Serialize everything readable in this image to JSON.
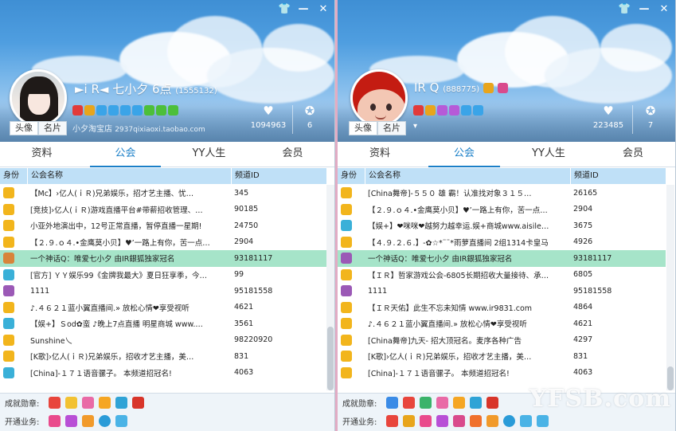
{
  "window_controls": {
    "skin": "👕",
    "minimize": "—",
    "close": "✕"
  },
  "left": {
    "nick": "►i R◄ 七小夕 6点",
    "uid": "(1555132)",
    "shop_label": "小夕淘宝店",
    "shop_url": "2937qixiaoxi.taobao.com",
    "likes": "1094963",
    "honor": "6",
    "mini_tabs": [
      "头像",
      "名片"
    ],
    "tabs": [
      "资料",
      "公会",
      "YY人生",
      "会员"
    ],
    "active_tab": 1,
    "columns": [
      "身份",
      "公会名称",
      "频道ID"
    ],
    "rows": [
      {
        "name": "【Mc】›亿人(ｉＲ)兄弟娱乐，招才艺主播、忧…",
        "id": "345"
      },
      {
        "name": "[竞技]›亿人(ｉＲ)游戏直播平台#带薪招收管理、…",
        "id": "90185"
      },
      {
        "name": "小亚外地演出中，12号正常直播，暂停直播一星期!",
        "id": "24750"
      },
      {
        "name": "【２.９.ｏ４.•金鹰莫小贝】♥’一路上有你，苦一点…",
        "id": "2904"
      },
      {
        "name": "一个神话Q：唯爱七小夕 由IR銀狐独家冠名",
        "id": "93181117"
      },
      {
        "name": "[官方] ＹＹ娱乐99《金牌我最大》夏日狂享季，今…",
        "id": "99"
      },
      {
        "name": "1111",
        "id": "95181558"
      },
      {
        "name": "♪.４６２１蓝小翼直播间.» 放松心情❤享受视听",
        "id": "4621"
      },
      {
        "name": "【娱+】Ｓod✿蛮 ♪晚上7点直播     明星商城 www.…",
        "id": "3561"
      },
      {
        "name": "Sunshine乀",
        "id": "98220920"
      },
      {
        "name": "[K歌]›亿人(ｉＲ)兄弟娱乐，招收才艺主播，美…",
        "id": "831"
      },
      {
        "name": "[China]-１７１语音骡子。 本频道招冠名!",
        "id": "4063"
      }
    ],
    "highlight_row": 4,
    "footer": {
      "label1": "成就勋章:",
      "label2": "开通业务:"
    }
  },
  "right": {
    "nick": "IR Q",
    "uid": "(888775)",
    "likes": "223485",
    "honor": "7",
    "mini_tabs": [
      "头像",
      "名片"
    ],
    "tabs": [
      "资料",
      "公会",
      "YY人生",
      "会员"
    ],
    "active_tab": 1,
    "columns": [
      "身份",
      "公会名称",
      "频道ID"
    ],
    "rows": [
      {
        "name": "[China舞帝]-５５０ 雄 霸！认准找对象３１５…",
        "id": "26165"
      },
      {
        "name": "【２.９.ｏ４.•金鹰莫小贝】♥’一路上有你，苦一点…",
        "id": "2904"
      },
      {
        "name": "【娱+】❤咪咪❤越努力越幸运.娱+商城www.aisile…",
        "id": "3675"
      },
      {
        "name": "【４.９.２.６.】-✿☆*¨¨*雨萝直播间 2组1314卡皇马",
        "id": "4926"
      },
      {
        "name": "一个神话Q：唯爱七小夕 由IR銀狐独家冠名",
        "id": "93181117"
      },
      {
        "name": "【ＩＲ】哲家游戏公会-6805长期招收大量接待、承…",
        "id": "6805"
      },
      {
        "name": "1111",
        "id": "95181558"
      },
      {
        "name": "【ＩＲ天佑】此生不忘未知情 www.ir9831.com",
        "id": "4864"
      },
      {
        "name": "♪.４６２１蓝小翼直播间.» 放松心情❤享受视听",
        "id": "4621"
      },
      {
        "name": "[China舞帝]九天- 招大顶冠名。麦序各种广告",
        "id": "4297"
      },
      {
        "name": "[K歌]›亿人(ｉＲ)兄弟娱乐，招收才艺主播，美…",
        "id": "831"
      },
      {
        "name": "[China]-１７１语音骡子。 本频道招冠名!",
        "id": "4063"
      }
    ],
    "highlight_row": 4,
    "footer": {
      "label1": "成就勋章:",
      "label2": "开通业务:"
    }
  },
  "watermark": "YFSB.com",
  "colors": {
    "accent": "#1a7fc8",
    "highlight_row": "#a6e4c9",
    "table_header": "#bfe0f7"
  },
  "icons": {
    "like": "heart-icon",
    "honor": "award-icon",
    "role": "member-role-icon"
  }
}
